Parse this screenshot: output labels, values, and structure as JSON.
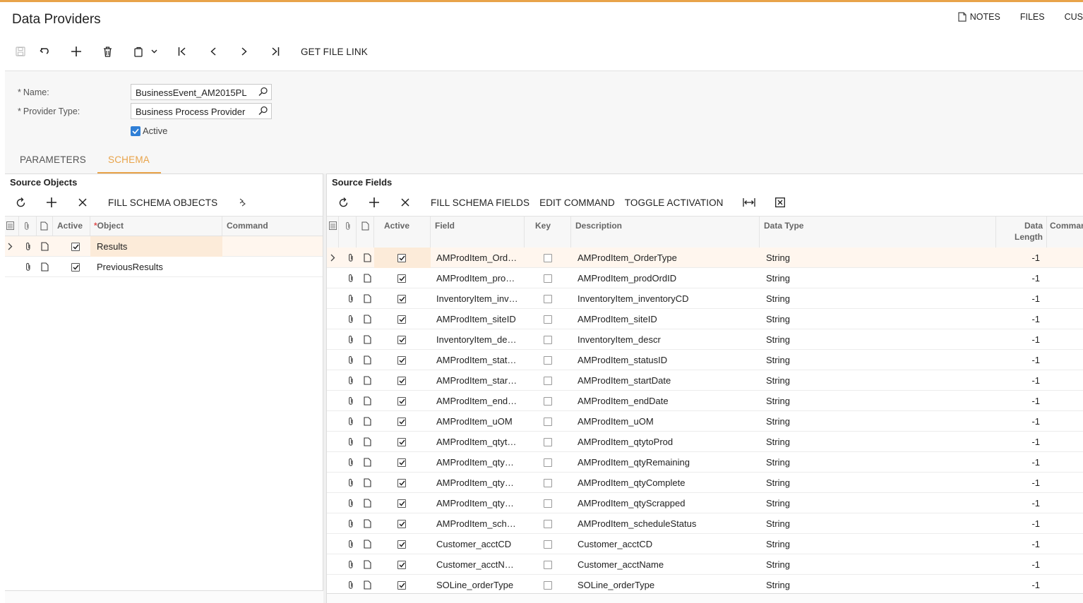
{
  "page": {
    "title": "Data Providers"
  },
  "top_links": [
    {
      "label": "NOTES",
      "icon": "note-icon"
    },
    {
      "label": "FILES"
    },
    {
      "label": "CUS"
    }
  ],
  "toolbar": {
    "get_file_link": "GET FILE LINK",
    "icons": [
      "save-icon",
      "undo-icon",
      "add-icon",
      "delete-icon",
      "copy-paste-icon",
      "dropdown-icon",
      "first-record-icon",
      "previous-record-icon",
      "next-record-icon",
      "last-record-icon"
    ]
  },
  "form": {
    "name_label": "Name:",
    "name_value": "BusinessEvent_AM2015PL",
    "provider_type_label": "Provider Type:",
    "provider_type_value": "Business Process Provider",
    "active_label": "Active",
    "active_checked": true
  },
  "tabs": [
    {
      "label": "PARAMETERS",
      "active": false
    },
    {
      "label": "SCHEMA",
      "active": true
    }
  ],
  "source_objects": {
    "title": "Source Objects",
    "fill_label": "FILL SCHEMA OBJECTS",
    "columns": {
      "active": "Active",
      "object": "Object",
      "command": "Command"
    },
    "rows": [
      {
        "object": "Results",
        "active": true,
        "selected": true
      },
      {
        "object": "PreviousResults",
        "active": true,
        "selected": false
      }
    ]
  },
  "source_fields": {
    "title": "Source Fields",
    "fill_label": "FILL SCHEMA FIELDS",
    "edit_label": "EDIT COMMAND",
    "toggle_label": "TOGGLE ACTIVATION",
    "columns": {
      "active": "Active",
      "field": "Field",
      "key": "Key",
      "description": "Description",
      "data_type": "Data Type",
      "data_length_1": "Data",
      "data_length_2": "Length",
      "command": "Commar"
    },
    "rows": [
      {
        "field": "AMProdItem_Ord…",
        "description": "AMProdItem_OrderType",
        "type": "String",
        "length": "-1"
      },
      {
        "field": "AMProdItem_pro…",
        "description": "AMProdItem_prodOrdID",
        "type": "String",
        "length": "-1"
      },
      {
        "field": "InventoryItem_inv…",
        "description": "InventoryItem_inventoryCD",
        "type": "String",
        "length": "-1"
      },
      {
        "field": "AMProdItem_siteID",
        "description": "AMProdItem_siteID",
        "type": "String",
        "length": "-1"
      },
      {
        "field": "InventoryItem_de…",
        "description": "InventoryItem_descr",
        "type": "String",
        "length": "-1"
      },
      {
        "field": "AMProdItem_stat…",
        "description": "AMProdItem_statusID",
        "type": "String",
        "length": "-1"
      },
      {
        "field": "AMProdItem_star…",
        "description": "AMProdItem_startDate",
        "type": "String",
        "length": "-1"
      },
      {
        "field": "AMProdItem_end…",
        "description": "AMProdItem_endDate",
        "type": "String",
        "length": "-1"
      },
      {
        "field": "AMProdItem_uOM",
        "description": "AMProdItem_uOM",
        "type": "String",
        "length": "-1"
      },
      {
        "field": "AMProdItem_qtyt…",
        "description": "AMProdItem_qtytoProd",
        "type": "String",
        "length": "-1"
      },
      {
        "field": "AMProdItem_qty…",
        "description": "AMProdItem_qtyRemaining",
        "type": "String",
        "length": "-1"
      },
      {
        "field": "AMProdItem_qty…",
        "description": "AMProdItem_qtyComplete",
        "type": "String",
        "length": "-1"
      },
      {
        "field": "AMProdItem_qty…",
        "description": "AMProdItem_qtyScrapped",
        "type": "String",
        "length": "-1"
      },
      {
        "field": "AMProdItem_sch…",
        "description": "AMProdItem_scheduleStatus",
        "type": "String",
        "length": "-1"
      },
      {
        "field": "Customer_acctCD",
        "description": "Customer_acctCD",
        "type": "String",
        "length": "-1"
      },
      {
        "field": "Customer_acctN…",
        "description": "Customer_acctName",
        "type": "String",
        "length": "-1"
      },
      {
        "field": "SOLine_orderType",
        "description": "SOLine_orderType",
        "type": "String",
        "length": "-1"
      }
    ]
  },
  "colors": {
    "accent": "#e8a349",
    "checkbox_blue": "#2f7fd6",
    "selected_row": "#fff6ee"
  }
}
